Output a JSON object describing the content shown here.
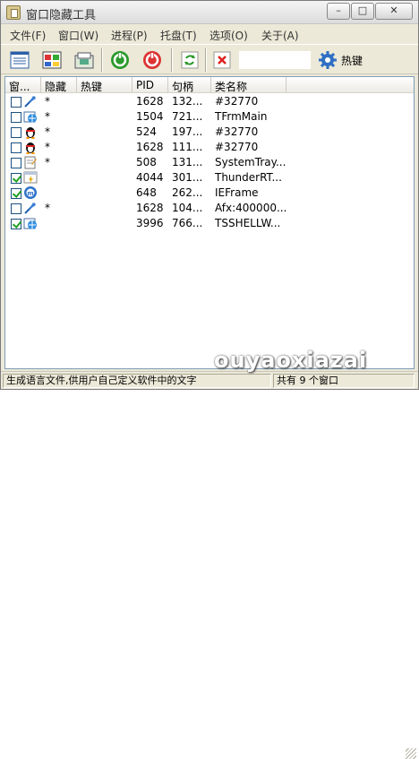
{
  "window": {
    "title": "窗口隐藏工具",
    "minimize_glyph": "–",
    "maximize_glyph": "□",
    "close_glyph": "✕"
  },
  "menu": [
    {
      "label": "文件(F)"
    },
    {
      "label": "窗口(W)"
    },
    {
      "label": "进程(P)"
    },
    {
      "label": "托盘(T)"
    },
    {
      "label": "选项(O)"
    },
    {
      "label": "关于(A)"
    }
  ],
  "toolbar": {
    "hotkey_label": "热键",
    "hotkey_value": "",
    "icons": [
      "list-view-icon",
      "window-grid-icon",
      "tray-icon",
      "refresh-green-icon",
      "refresh-red-icon",
      "reload-icon",
      "delete-icon",
      "gear-icon"
    ]
  },
  "table": {
    "columns": [
      "窗...",
      "隐藏",
      "热键",
      "PID",
      "句柄",
      "类名称"
    ],
    "rows": [
      {
        "checked": false,
        "icon": "feather-icon",
        "hidden": "*",
        "hotkey": "",
        "pid": "1628",
        "handle": "132...",
        "class": "#32770"
      },
      {
        "checked": false,
        "icon": "globe-window-icon",
        "hidden": "*",
        "hotkey": "",
        "pid": "1504",
        "handle": "721...",
        "class": "TFrmMain"
      },
      {
        "checked": false,
        "icon": "penguin-icon",
        "hidden": "*",
        "hotkey": "",
        "pid": "524",
        "handle": "197...",
        "class": "#32770"
      },
      {
        "checked": false,
        "icon": "penguin-icon",
        "hidden": "*",
        "hotkey": "",
        "pid": "1628",
        "handle": "111...",
        "class": "#32770"
      },
      {
        "checked": false,
        "icon": "notepad-icon",
        "hidden": "*",
        "hotkey": "",
        "pid": "508",
        "handle": "131...",
        "class": "SystemTray..."
      },
      {
        "checked": true,
        "icon": "thunder-window-icon",
        "hidden": "",
        "hotkey": "",
        "pid": "4044",
        "handle": "301...",
        "class": "ThunderRT..."
      },
      {
        "checked": true,
        "icon": "maxthon-icon",
        "hidden": "",
        "hotkey": "",
        "pid": "648",
        "handle": "262...",
        "class": "IEFrame"
      },
      {
        "checked": false,
        "icon": "feather-icon",
        "hidden": "*",
        "hotkey": "",
        "pid": "1628",
        "handle": "104...",
        "class": "Afx:400000..."
      },
      {
        "checked": true,
        "icon": "globe-window-icon",
        "hidden": "",
        "hotkey": "",
        "pid": "3996",
        "handle": "766...",
        "class": "TSSHELLW..."
      }
    ]
  },
  "status": {
    "left": "生成语言文件,供用户自己定义软件中的文字",
    "right": "共有 9 个窗口"
  },
  "watermark": "ouyaoxiazai",
  "colors": {
    "accent_green": "#21a121",
    "checkbox_border": "#1c5180",
    "list_border": "#7f9db9",
    "window_bg": "#ece9d8"
  }
}
